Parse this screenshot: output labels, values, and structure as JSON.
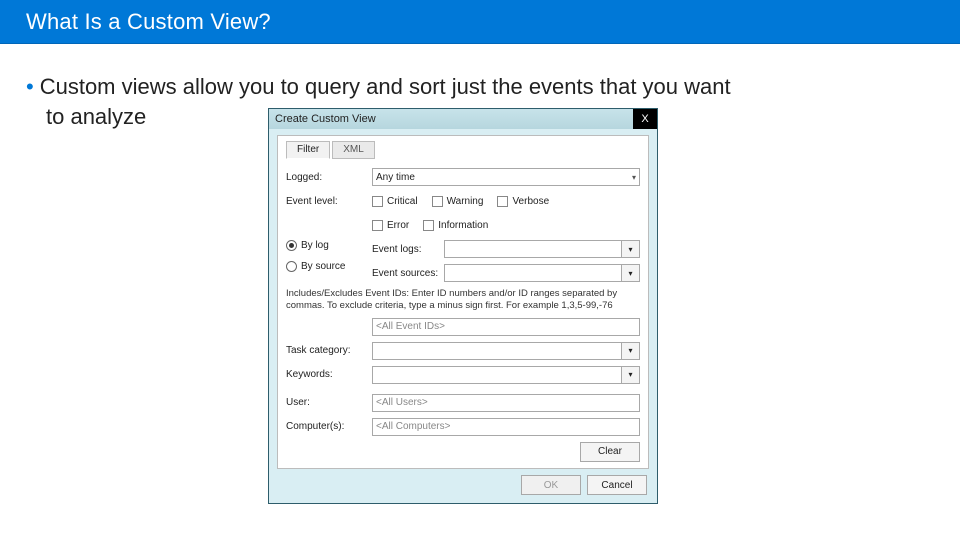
{
  "slide": {
    "title": "What Is a Custom View?",
    "bullet": "Custom views allow you to query and sort just the events that you want",
    "bullet_cont": "to analyze"
  },
  "dialog": {
    "title": "Create Custom View",
    "close": "X",
    "tabs": {
      "filter": "Filter",
      "xml": "XML"
    },
    "labels": {
      "logged": "Logged:",
      "event_level": "Event level:",
      "by_log": "By log",
      "by_source": "By source",
      "event_logs": "Event logs:",
      "event_sources": "Event sources:",
      "task_category": "Task category:",
      "keywords": "Keywords:",
      "user": "User:",
      "computers": "Computer(s):"
    },
    "levels": {
      "critical": "Critical",
      "warning": "Warning",
      "verbose": "Verbose",
      "error": "Error",
      "information": "Information"
    },
    "values": {
      "logged": "Any time",
      "event_ids": "<All Event IDs>",
      "user": "<All Users>",
      "computers": "<All Computers>"
    },
    "hint": "Includes/Excludes Event IDs: Enter ID numbers and/or ID ranges separated by commas. To exclude criteria, type a minus sign first. For example 1,3,5-99,-76",
    "buttons": {
      "clear": "Clear",
      "ok": "OK",
      "cancel": "Cancel"
    }
  }
}
